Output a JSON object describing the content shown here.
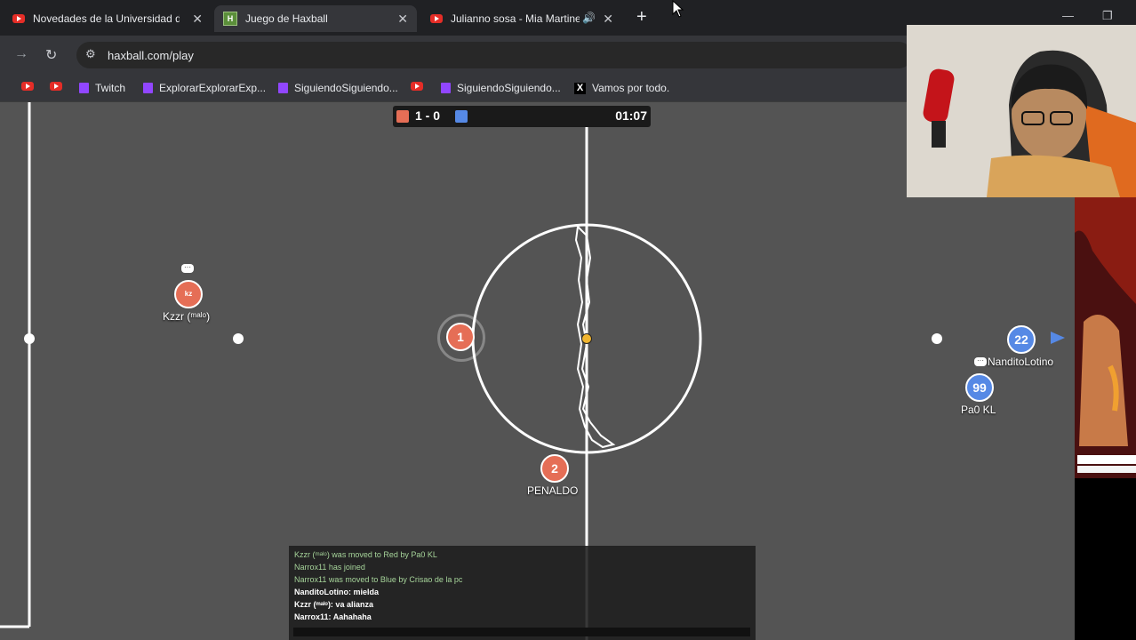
{
  "tabs": [
    {
      "title": "Novedades de la Universidad d",
      "icon": "youtube-icon",
      "active": false
    },
    {
      "title": "Juego de Haxball",
      "icon": "haxball-icon",
      "active": true
    },
    {
      "title": "Julianno sosa - Mia Martine",
      "icon": "youtube-icon",
      "active": false
    }
  ],
  "toolbar": {
    "url": "haxball.com/play"
  },
  "bookmarks": [
    {
      "label": "",
      "icon": "youtube-icon"
    },
    {
      "label": "",
      "icon": "youtube-icon"
    },
    {
      "label": "Twitch",
      "icon": "twitch-icon"
    },
    {
      "label": "ExplorarExplorarExp...",
      "icon": "twitch-icon"
    },
    {
      "label": "SiguiendoSiguiendo...",
      "icon": "twitch-icon"
    },
    {
      "label": "",
      "icon": "youtube-icon"
    },
    {
      "label": "SiguiendoSiguiendo...",
      "icon": "twitch-icon"
    },
    {
      "label": "Vamos por todo.",
      "icon": "x-icon"
    }
  ],
  "scoreboard": {
    "score": "1 - 0",
    "time": "01:07",
    "red_color": "#e56e56",
    "blue_color": "#5689e5"
  },
  "players": {
    "p1": {
      "number": "1",
      "team": "red"
    },
    "p2": {
      "number": "2",
      "name": "PENALDO",
      "team": "red"
    },
    "p3": {
      "avatar": "kz",
      "name": "Kzzr (ᵐᵃˡᵒ)",
      "team": "red"
    },
    "p4": {
      "number": "22",
      "name": "NanditoLotino",
      "team": "blue"
    },
    "p5": {
      "number": "99",
      "name": "Pa0 KL",
      "team": "blue"
    }
  },
  "chat": [
    {
      "text": "Kzzr (ᵐᵃˡᵒ) was moved to Red by Pa0 KL",
      "kind": "sys"
    },
    {
      "text": "Narrox11 has joined",
      "kind": "sys"
    },
    {
      "text": "Narrox11 was moved to Blue by Crisao de la pc",
      "kind": "sys"
    },
    {
      "text": "NanditoLotino: mielda",
      "kind": "msg"
    },
    {
      "text": "Kzzr (ᵐᵃˡᵒ): va alianza",
      "kind": "msg"
    },
    {
      "text": "Narrox11: Aahahaha",
      "kind": "msg"
    }
  ]
}
